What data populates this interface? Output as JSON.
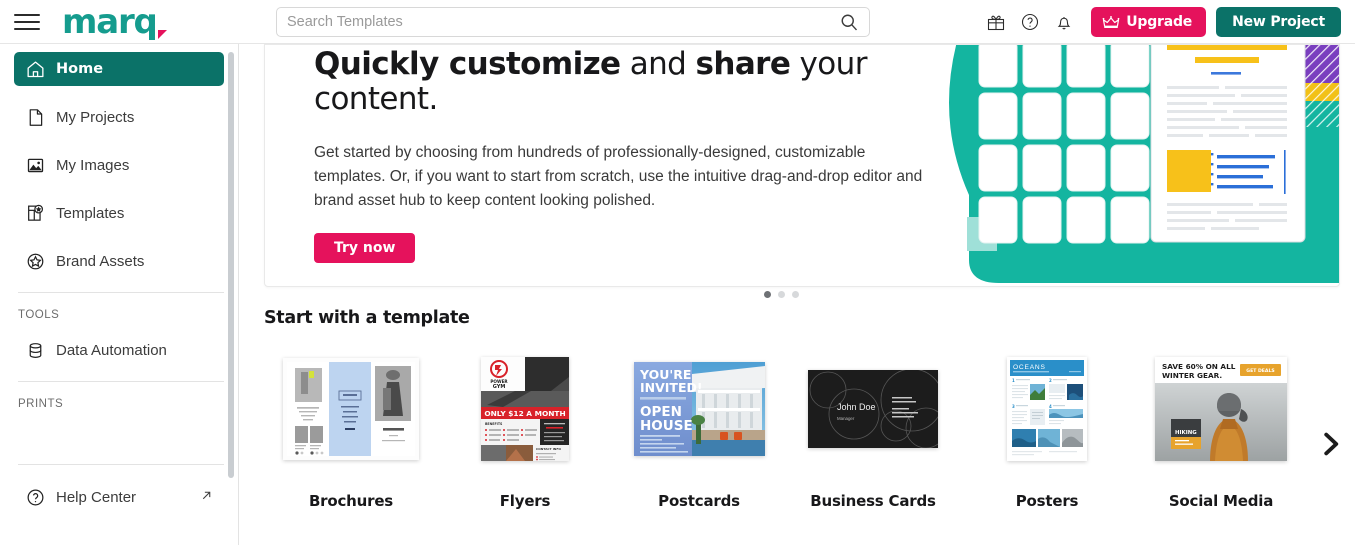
{
  "app": {
    "brand": "marq",
    "accent_teal": "#0b7268",
    "accent_logo_teal": "#159c8e",
    "accent_pink": "#e5125c"
  },
  "topbar": {
    "menu_icon": "hamburger-icon",
    "search": {
      "placeholder": "Search Templates",
      "value": "",
      "icon": "search-icon"
    },
    "icons": [
      {
        "name": "gift-icon",
        "label": "Gifts"
      },
      {
        "name": "help-circle-icon",
        "label": "Help"
      },
      {
        "name": "bell-icon",
        "label": "Notifications"
      }
    ],
    "upgrade_label": "Upgrade",
    "upgrade_icon": "crown-icon",
    "new_project_label": "New Project"
  },
  "sidebar": {
    "items": [
      {
        "label": "Home",
        "icon": "home-icon",
        "active": true
      },
      {
        "label": "My Projects",
        "icon": "document-icon",
        "active": false
      },
      {
        "label": "My Images",
        "icon": "image-icon",
        "active": false
      },
      {
        "label": "Templates",
        "icon": "templates-icon",
        "active": false
      },
      {
        "label": "Brand Assets",
        "icon": "star-badge-icon",
        "active": false
      }
    ],
    "sections": [
      {
        "title": "TOOLS",
        "items": [
          {
            "label": "Data Automation",
            "icon": "database-icon"
          }
        ]
      },
      {
        "title": "PRINTS",
        "items": []
      }
    ],
    "help": {
      "label": "Help Center",
      "icon": "help-circle-icon",
      "external_icon": "external-link-icon"
    }
  },
  "hero": {
    "title_part1": "Quickly customize",
    "title_part2": " and ",
    "title_part3": "share",
    "title_part4": " your content.",
    "body": "Get started by choosing from hundreds of professionally-designed, customizable templates. Or, if you want to start from scratch, use the intuitive drag-and-drop editor and brand asset hub to keep content looking polished.",
    "cta_label": "Try now",
    "carousel": {
      "total": 3,
      "active_index": 0
    }
  },
  "templates": {
    "section_title": "Start with a template",
    "next_icon": "chevron-right-icon",
    "cards": [
      {
        "label": "Brochures",
        "thumb": "brochure-trifold-thumb"
      },
      {
        "label": "Flyers",
        "thumb": "gym-flyer-thumb",
        "text": "ONLY $12 A MONTH"
      },
      {
        "label": "Postcards",
        "thumb": "open-house-postcard-thumb",
        "text": "YOU'RE INVITED! OPEN HOUSE"
      },
      {
        "label": "Business Cards",
        "thumb": "business-card-thumb",
        "text": "John Doe"
      },
      {
        "label": "Posters",
        "thumb": "oceans-poster-thumb",
        "text": "OCEANS"
      },
      {
        "label": "Social Media",
        "thumb": "winter-gear-social-thumb",
        "text": "SAVE 60% ON ALL WINTER GEAR."
      }
    ]
  }
}
